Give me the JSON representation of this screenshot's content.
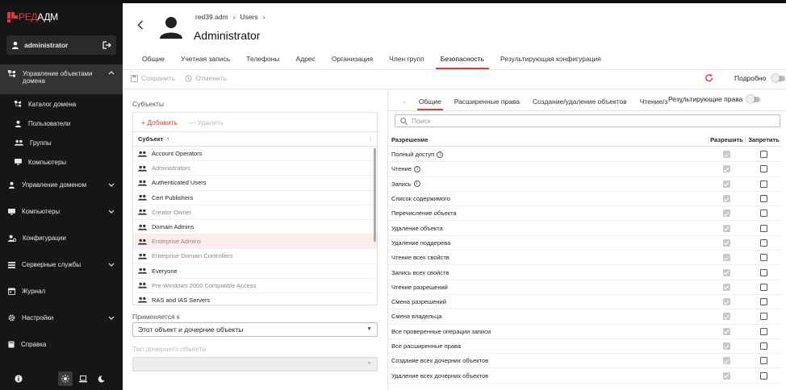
{
  "app": {
    "logo_accent": "РЕД",
    "logo_rest": "АДМ",
    "accent_color": "#e53935"
  },
  "user": {
    "name": "administrator"
  },
  "sidebar": {
    "groups": [
      {
        "label": "Управление объектами домена",
        "icon": "tree-icon",
        "expanded": true,
        "children": [
          {
            "label": "Каталог домена",
            "icon": "tree-icon"
          },
          {
            "label": "Пользователи",
            "icon": "person-icon"
          },
          {
            "label": "Группы",
            "icon": "group-icon"
          },
          {
            "label": "Компьютеры",
            "icon": "monitor-icon"
          }
        ]
      },
      {
        "label": "Управление доменом",
        "icon": "person-icon"
      },
      {
        "label": "Компьютеры",
        "icon": "monitor-icon"
      },
      {
        "label": "Конфигурации",
        "icon": "settings-person-icon"
      },
      {
        "label": "Серверные службы",
        "icon": "list-icon"
      },
      {
        "label": "Журнал",
        "icon": "journal-icon"
      },
      {
        "label": "Настройки",
        "icon": "gear-icon"
      },
      {
        "label": "Справка",
        "icon": "book-icon"
      }
    ]
  },
  "header": {
    "breadcrumb": [
      "red39.adm",
      "Users"
    ],
    "title": "Administrator",
    "tabs": [
      "Общие",
      "Учетная запись",
      "Телефоны",
      "Адрес",
      "Организация",
      "Член групп",
      "Безопасность",
      "Результирующая конфигурация"
    ],
    "active_tab": 6
  },
  "toolbar": {
    "save": "Сохранить",
    "cancel": "Отменить",
    "detailed": "Подробно"
  },
  "subjects": {
    "label": "Субъекты",
    "add": "Добавить",
    "delete": "Удалить",
    "column": "Субъект",
    "items": [
      {
        "name": "Account Operators",
        "grey": false
      },
      {
        "name": "Administrators",
        "grey": true
      },
      {
        "name": "Authenticated Users",
        "grey": false
      },
      {
        "name": "Cert Publishers",
        "grey": false
      },
      {
        "name": "Creator Owner",
        "grey": true
      },
      {
        "name": "Domain Admins",
        "grey": false
      },
      {
        "name": "Enterprise Admins",
        "grey": true,
        "selected": true
      },
      {
        "name": "Enterprise Domain Controllers",
        "grey": true
      },
      {
        "name": "Everyone",
        "grey": false
      },
      {
        "name": "Pre-Windows 2000 Compatible Access",
        "grey": true
      },
      {
        "name": "RAS and IAS Servers",
        "grey": false
      }
    ]
  },
  "applies": {
    "label": "Применяется к",
    "value": "Этот объект и дочерние объекты"
  },
  "child_type": {
    "label": "Тип дочернего объекта",
    "value": ""
  },
  "perm_tabs": {
    "items": [
      "Общие",
      "Расширенные права",
      "Создание/удаление объектов",
      "Чтение/з"
    ],
    "active": 0,
    "resulting": "Результирующие права"
  },
  "search": {
    "placeholder": "Поиск"
  },
  "permissions": {
    "col_perm": "Разрешение",
    "col_allow": "Разрешить",
    "col_deny": "Запретить",
    "rows": [
      {
        "name": "Полный доступ",
        "info": true
      },
      {
        "name": "Чтение",
        "info": true
      },
      {
        "name": "Запись",
        "info": true
      },
      {
        "name": "Список содержимого",
        "info": false
      },
      {
        "name": "Перечисление объекта",
        "info": false
      },
      {
        "name": "Удаление объекта",
        "info": false
      },
      {
        "name": "Удаление поддерева",
        "info": false
      },
      {
        "name": "Чтение всех свойств",
        "info": false
      },
      {
        "name": "Запись всех свойств",
        "info": false
      },
      {
        "name": "Чтение разрешений",
        "info": false
      },
      {
        "name": "Смена разрешений",
        "info": false
      },
      {
        "name": "Смена владельца",
        "info": false
      },
      {
        "name": "Все проверенные операции записи",
        "info": false
      },
      {
        "name": "Все расширенные права",
        "info": false
      },
      {
        "name": "Создание всех дочерних объектов",
        "info": false
      },
      {
        "name": "Удаление всех дочерних объектов",
        "info": false
      }
    ]
  }
}
